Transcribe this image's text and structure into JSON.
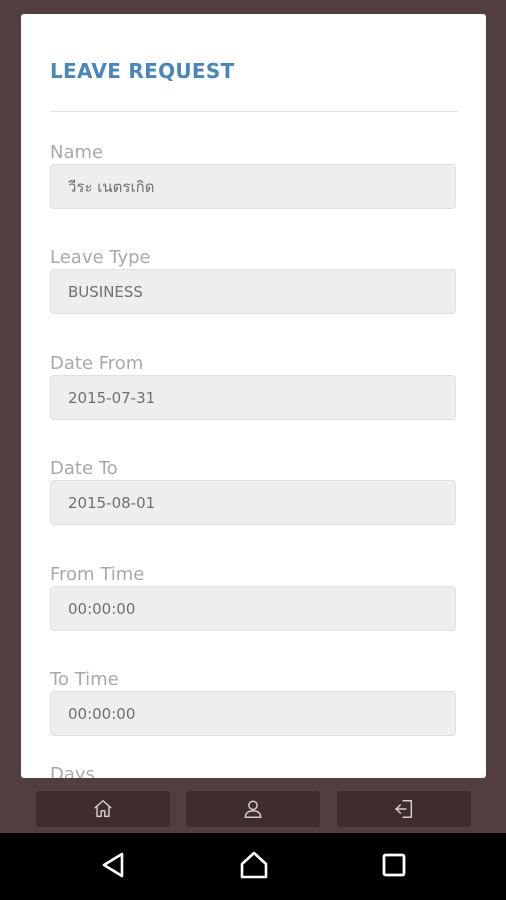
{
  "form": {
    "title": "LEAVE REQUEST",
    "fields": [
      {
        "label": "Name",
        "value": "วีระ  เนตรเกิด"
      },
      {
        "label": "Leave Type",
        "value": "BUSINESS"
      },
      {
        "label": "Date From",
        "value": "2015-07-31"
      },
      {
        "label": "Date To",
        "value": "2015-08-01"
      },
      {
        "label": "From Time",
        "value": "00:00:00"
      },
      {
        "label": "To Time",
        "value": "00:00:00"
      },
      {
        "label": "Days",
        "value": ""
      }
    ]
  },
  "bottom_tabs": {
    "items": [
      {
        "icon": "home-icon"
      },
      {
        "icon": "user-icon"
      },
      {
        "icon": "logout-icon"
      }
    ]
  },
  "system_nav": {
    "items": [
      {
        "icon": "back-icon"
      },
      {
        "icon": "home-icon"
      },
      {
        "icon": "recents-icon"
      }
    ]
  },
  "colors": {
    "background": "#523e3e",
    "title": "#4a86b8",
    "label": "#a6aaae",
    "input_bg": "#eeeeee",
    "tab_bg": "#3f2d2d",
    "nav_bg": "#000000"
  }
}
